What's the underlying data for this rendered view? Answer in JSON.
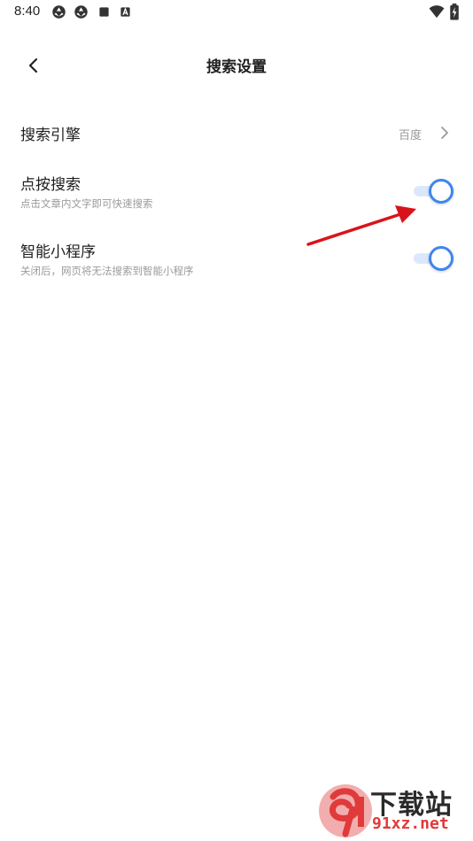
{
  "status_bar": {
    "time": "8:40",
    "left_icons": [
      "aperture-icon",
      "aperture-icon",
      "stop-square-icon",
      "a-badge-icon"
    ],
    "right_icons": [
      "wifi-icon",
      "battery-charging-icon"
    ]
  },
  "header": {
    "title": "搜索设置",
    "back_icon": "chevron-left-icon"
  },
  "settings": {
    "search_engine": {
      "title": "搜索引擎",
      "value": "百度"
    },
    "tap_search": {
      "title": "点按搜索",
      "subtitle": "点击文章内文字即可快速搜索",
      "enabled": true
    },
    "mini_program": {
      "title": "智能小程序",
      "subtitle": "关闭后，网页将无法搜索到智能小程序",
      "enabled": true
    }
  },
  "colors": {
    "accent": "#3f86ee",
    "toggle_track": "#dbe8fb",
    "annotation_arrow": "#d8141b"
  },
  "watermark": {
    "line1": "下载站",
    "line2": "91xz.net"
  }
}
